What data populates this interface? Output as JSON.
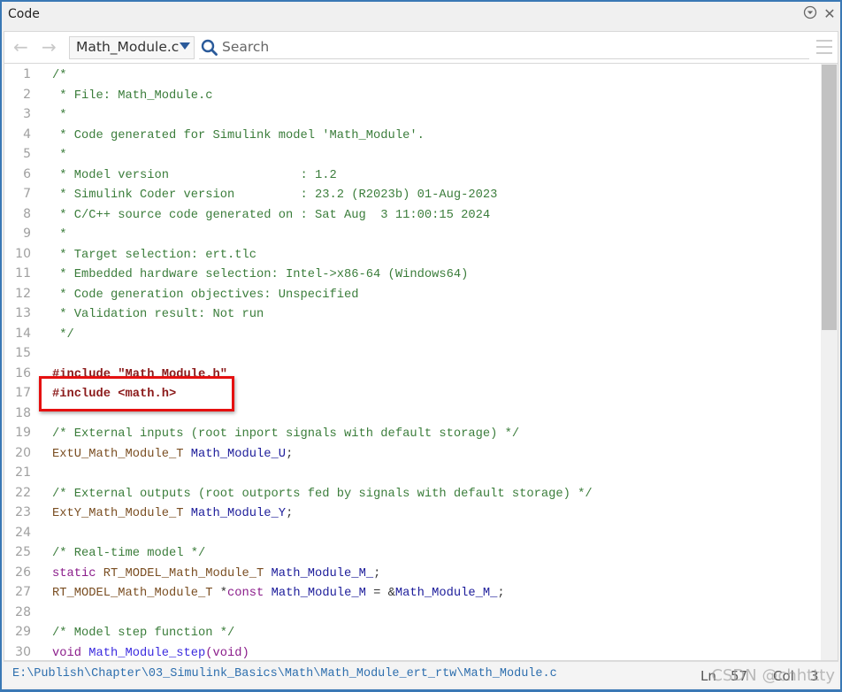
{
  "window": {
    "title": "Code"
  },
  "toolbar": {
    "file": "Math_Module.c",
    "search_placeholder": "Search"
  },
  "code_lines": [
    [
      [
        "c",
        "/*"
      ]
    ],
    [
      [
        "c",
        " * File: Math_Module.c"
      ]
    ],
    [
      [
        "c",
        " *"
      ]
    ],
    [
      [
        "c",
        " * Code generated for Simulink model 'Math_Module'."
      ]
    ],
    [
      [
        "c",
        " *"
      ]
    ],
    [
      [
        "c",
        " * Model version                  : 1.2"
      ]
    ],
    [
      [
        "c",
        " * Simulink Coder version         : 23.2 (R2023b) 01-Aug-2023"
      ]
    ],
    [
      [
        "c",
        " * C/C++ source code generated on : Sat Aug  3 11:00:15 2024"
      ]
    ],
    [
      [
        "c",
        " *"
      ]
    ],
    [
      [
        "c",
        " * Target selection: ert.tlc"
      ]
    ],
    [
      [
        "c",
        " * Embedded hardware selection: Intel->x86-64 (Windows64)"
      ]
    ],
    [
      [
        "c",
        " * Code generation objectives: Unspecified"
      ]
    ],
    [
      [
        "c",
        " * Validation result: Not run"
      ]
    ],
    [
      [
        "c",
        " */"
      ]
    ],
    [],
    [
      [
        "p",
        "#include \"Math_Module.h\""
      ]
    ],
    [
      [
        "p",
        "#include <math.h>"
      ]
    ],
    [],
    [
      [
        "c",
        "/* External inputs (root inport signals with default storage) */"
      ]
    ],
    [
      [
        "t",
        "ExtU_Math_Module_T "
      ],
      [
        "g",
        "Math_Module_U"
      ],
      [
        "x",
        ";"
      ]
    ],
    [],
    [
      [
        "c",
        "/* External outputs (root outports fed by signals with default storage) */"
      ]
    ],
    [
      [
        "t",
        "ExtY_Math_Module_T "
      ],
      [
        "g",
        "Math_Module_Y"
      ],
      [
        "x",
        ";"
      ]
    ],
    [],
    [
      [
        "c",
        "/* Real-time model */"
      ]
    ],
    [
      [
        "k",
        "static "
      ],
      [
        "t",
        "RT_MODEL_Math_Module_T "
      ],
      [
        "g",
        "Math_Module_M_"
      ],
      [
        "x",
        ";"
      ]
    ],
    [
      [
        "t",
        "RT_MODEL_Math_Module_T "
      ],
      [
        "x",
        "*"
      ],
      [
        "k",
        "const "
      ],
      [
        "g",
        "Math_Module_M"
      ],
      [
        "x",
        " = &"
      ],
      [
        "g",
        "Math_Module_M_"
      ],
      [
        "x",
        ";"
      ]
    ],
    [],
    [
      [
        "c",
        "/* Model step function */"
      ]
    ],
    [
      [
        "k",
        "void "
      ],
      [
        "f",
        "Math_Module_step"
      ],
      [
        "k",
        "(void)"
      ]
    ]
  ],
  "status": {
    "path": "E:\\Publish\\Chapter\\03_Simulink_Basics\\Math\\Math_Module_ert_rtw\\Math_Module.c",
    "ln_label": "Ln",
    "ln": "57",
    "col_label": "Col",
    "col": "3",
    "watermark": "CSDN @chhttty"
  },
  "colors": {
    "highlight_box": "#e51010",
    "comment": "#3b7d3b",
    "preprocessor": "#8b1a1a",
    "keyword": "#8b1d8b"
  }
}
